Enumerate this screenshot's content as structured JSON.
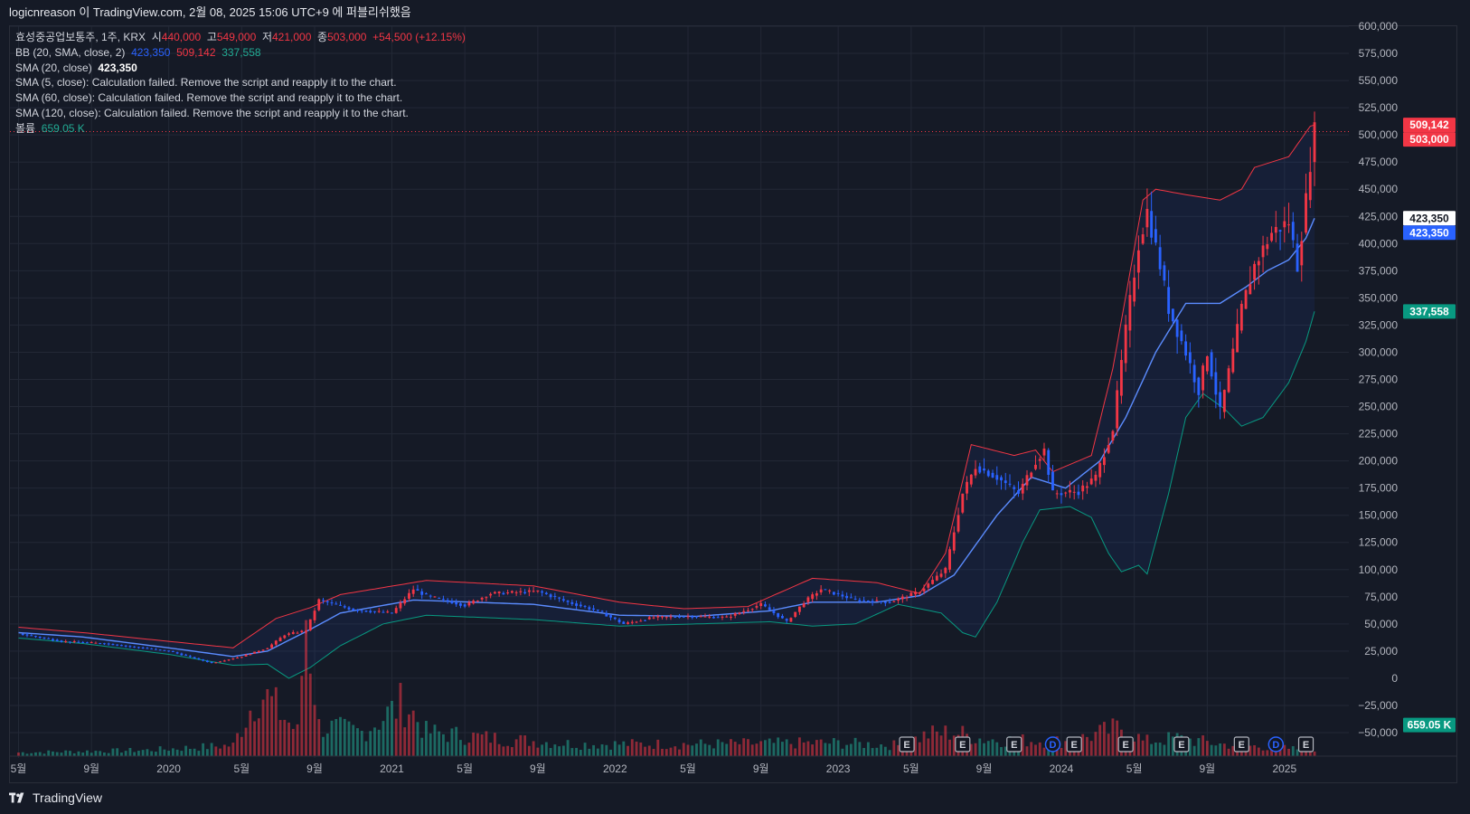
{
  "header": {
    "publish_line": "logicnreason 이 TradingView.com, 2월 08, 2025 15:06 UTC+9 에 퍼블리쉬했음"
  },
  "legend": {
    "symbol": "효성중공업보통주, 1주, KRX",
    "open_label": "시",
    "open": "440,000",
    "high_label": "고",
    "high": "549,000",
    "low_label": "저",
    "low": "421,000",
    "close_label": "종",
    "close": "503,000",
    "change": "+54,500 (+12.15%)",
    "bb_label": "BB (20, SMA, close, 2)",
    "bb_basis": "423,350",
    "bb_upper": "509,142",
    "bb_lower": "337,558",
    "sma20_label": "SMA (20, close)",
    "sma20_value": "423,350",
    "sma5_msg": "SMA (5, close): Calculation failed. Remove the script and reapply it to the chart.",
    "sma60_msg": "SMA (60, close): Calculation failed. Remove the script and reapply it to the chart.",
    "sma120_msg": "SMA (120, close): Calculation failed. Remove the script and reapply it to the chart.",
    "volume_label": "볼륨",
    "volume_value": "659.05 K"
  },
  "footer": {
    "brand": "TradingView"
  },
  "colors": {
    "up": "#f23645",
    "down": "#2962ff",
    "bb_upper": "#f23645",
    "bb_basis": "#5b8cff",
    "bb_lower": "#089981",
    "bg": "#151a26",
    "grid": "#232836"
  },
  "chart_data": {
    "type": "candlestick",
    "interval": "1W",
    "y_ticks": [
      "600,000",
      "575,000",
      "550,000",
      "525,000",
      "500,000",
      "475,000",
      "450,000",
      "425,000",
      "400,000",
      "375,000",
      "350,000",
      "325,000",
      "300,000",
      "275,000",
      "250,000",
      "225,000",
      "200,000",
      "175,000",
      "150,000",
      "125,000",
      "100,000",
      "75,000",
      "50,000",
      "25,000",
      "0",
      "−25,000",
      "−50,000"
    ],
    "ylim": [
      -50000,
      600000
    ],
    "x_labels": [
      "5월",
      "9월",
      "2020",
      "5월",
      "9월",
      "2021",
      "5월",
      "9월",
      "2022",
      "5월",
      "9월",
      "2023",
      "5월",
      "9월",
      "2024",
      "5월",
      "9월",
      "2025"
    ],
    "x_label_pos": [
      0,
      17,
      35,
      52,
      69,
      87,
      104,
      121,
      139,
      156,
      173,
      191,
      208,
      225,
      243,
      260,
      277,
      295
    ],
    "x_range": [
      -2,
      310
    ],
    "price_badges": [
      {
        "text": "509,142",
        "value": 509142,
        "bg": "#f23645",
        "fg": "#ffffff"
      },
      {
        "text": "503,000",
        "value": 503000,
        "bg": "#f23645",
        "fg": "#ffffff"
      },
      {
        "text": "423,350",
        "value": 423350,
        "bg": "#ffffff",
        "fg": "#131722"
      },
      {
        "text": "423,350",
        "value": 423350,
        "bg": "#2962ff",
        "fg": "#ffffff"
      },
      {
        "text": "337,558",
        "value": 337558,
        "bg": "#089981",
        "fg": "#ffffff"
      },
      {
        "text": "659.05 K",
        "value": -43000,
        "bg": "#089981",
        "fg": "#ffffff"
      }
    ],
    "last_price": 503000,
    "events": [
      {
        "type": "E",
        "x": 207
      },
      {
        "type": "E",
        "x": 220
      },
      {
        "type": "E",
        "x": 232
      },
      {
        "type": "D",
        "x": 241
      },
      {
        "type": "E",
        "x": 246
      },
      {
        "type": "E",
        "x": 258
      },
      {
        "type": "E",
        "x": 271
      },
      {
        "type": "E",
        "x": 285
      },
      {
        "type": "D",
        "x": 293
      },
      {
        "type": "E",
        "x": 300
      }
    ],
    "close_keypoints": [
      [
        0,
        41000
      ],
      [
        10,
        34000
      ],
      [
        20,
        32000
      ],
      [
        35,
        25000
      ],
      [
        45,
        14000
      ],
      [
        52,
        20000
      ],
      [
        58,
        28000
      ],
      [
        62,
        40000
      ],
      [
        67,
        44000
      ],
      [
        70,
        72000
      ],
      [
        78,
        63000
      ],
      [
        87,
        60000
      ],
      [
        92,
        82000
      ],
      [
        95,
        76000
      ],
      [
        104,
        67000
      ],
      [
        110,
        78000
      ],
      [
        121,
        80000
      ],
      [
        128,
        70000
      ],
      [
        135,
        62000
      ],
      [
        141,
        50000
      ],
      [
        148,
        56000
      ],
      [
        156,
        57000
      ],
      [
        165,
        56000
      ],
      [
        173,
        68000
      ],
      [
        179,
        52000
      ],
      [
        183,
        70000
      ],
      [
        187,
        82000
      ],
      [
        195,
        72000
      ],
      [
        203,
        70000
      ],
      [
        210,
        80000
      ],
      [
        216,
        100000
      ],
      [
        220,
        170000
      ],
      [
        223,
        195000
      ],
      [
        228,
        185000
      ],
      [
        233,
        170000
      ],
      [
        237,
        200000
      ],
      [
        239,
        210000
      ],
      [
        241,
        170000
      ],
      [
        247,
        172000
      ],
      [
        251,
        185000
      ],
      [
        255,
        230000
      ],
      [
        258,
        320000
      ],
      [
        261,
        400000
      ],
      [
        263,
        430000
      ],
      [
        266,
        380000
      ],
      [
        268,
        340000
      ],
      [
        272,
        300000
      ],
      [
        275,
        265000
      ],
      [
        277,
        300000
      ],
      [
        280,
        245000
      ],
      [
        283,
        300000
      ],
      [
        285,
        340000
      ],
      [
        288,
        380000
      ],
      [
        292,
        410000
      ],
      [
        296,
        420000
      ],
      [
        298,
        380000
      ],
      [
        300,
        440000
      ],
      [
        301,
        475000
      ],
      [
        302,
        503000
      ]
    ],
    "bb_upper_keypoints": [
      [
        0,
        47000
      ],
      [
        15,
        42000
      ],
      [
        35,
        34000
      ],
      [
        50,
        28000
      ],
      [
        60,
        55000
      ],
      [
        68,
        65000
      ],
      [
        75,
        77000
      ],
      [
        95,
        90000
      ],
      [
        120,
        85000
      ],
      [
        140,
        70000
      ],
      [
        155,
        64000
      ],
      [
        170,
        66000
      ],
      [
        185,
        92000
      ],
      [
        200,
        88000
      ],
      [
        210,
        78000
      ],
      [
        216,
        115000
      ],
      [
        222,
        215000
      ],
      [
        232,
        205000
      ],
      [
        237,
        210000
      ],
      [
        241,
        190000
      ],
      [
        250,
        205000
      ],
      [
        255,
        285000
      ],
      [
        262,
        440000
      ],
      [
        265,
        450000
      ],
      [
        272,
        445000
      ],
      [
        280,
        440000
      ],
      [
        285,
        450000
      ],
      [
        288,
        470000
      ],
      [
        296,
        480000
      ],
      [
        301,
        508000
      ],
      [
        302,
        509142
      ]
    ],
    "bb_basis_keypoints": [
      [
        0,
        42000
      ],
      [
        15,
        38000
      ],
      [
        35,
        28000
      ],
      [
        50,
        20000
      ],
      [
        58,
        25000
      ],
      [
        68,
        45000
      ],
      [
        75,
        60000
      ],
      [
        92,
        72000
      ],
      [
        120,
        68000
      ],
      [
        140,
        58000
      ],
      [
        158,
        57000
      ],
      [
        175,
        62000
      ],
      [
        185,
        70000
      ],
      [
        200,
        70000
      ],
      [
        210,
        76000
      ],
      [
        218,
        95000
      ],
      [
        228,
        150000
      ],
      [
        236,
        185000
      ],
      [
        244,
        175000
      ],
      [
        252,
        200000
      ],
      [
        258,
        240000
      ],
      [
        265,
        300000
      ],
      [
        272,
        345000
      ],
      [
        280,
        345000
      ],
      [
        286,
        360000
      ],
      [
        291,
        375000
      ],
      [
        296,
        385000
      ],
      [
        300,
        405000
      ],
      [
        302,
        423350
      ]
    ],
    "bb_lower_keypoints": [
      [
        0,
        37000
      ],
      [
        15,
        32000
      ],
      [
        35,
        22000
      ],
      [
        50,
        12000
      ],
      [
        58,
        13000
      ],
      [
        63,
        0
      ],
      [
        68,
        10000
      ],
      [
        75,
        30000
      ],
      [
        85,
        50000
      ],
      [
        95,
        58000
      ],
      [
        120,
        54000
      ],
      [
        140,
        48000
      ],
      [
        158,
        50000
      ],
      [
        175,
        52000
      ],
      [
        185,
        48000
      ],
      [
        195,
        50000
      ],
      [
        205,
        68000
      ],
      [
        215,
        60000
      ],
      [
        220,
        42000
      ],
      [
        223,
        38000
      ],
      [
        228,
        70000
      ],
      [
        234,
        125000
      ],
      [
        238,
        155000
      ],
      [
        245,
        158000
      ],
      [
        250,
        148000
      ],
      [
        254,
        115000
      ],
      [
        257,
        98000
      ],
      [
        261,
        104000
      ],
      [
        263,
        96000
      ],
      [
        268,
        170000
      ],
      [
        272,
        240000
      ],
      [
        276,
        262000
      ],
      [
        281,
        248000
      ],
      [
        285,
        232000
      ],
      [
        290,
        240000
      ],
      [
        296,
        272000
      ],
      [
        300,
        310000
      ],
      [
        302,
        337558
      ]
    ],
    "volume_keypoints": [
      [
        0,
        3
      ],
      [
        30,
        5
      ],
      [
        50,
        9
      ],
      [
        56,
        55
      ],
      [
        60,
        40
      ],
      [
        65,
        20
      ],
      [
        67,
        120
      ],
      [
        70,
        25
      ],
      [
        80,
        20
      ],
      [
        90,
        45
      ],
      [
        95,
        20
      ],
      [
        110,
        15
      ],
      [
        130,
        10
      ],
      [
        160,
        10
      ],
      [
        190,
        11
      ],
      [
        205,
        9
      ],
      [
        212,
        18
      ],
      [
        218,
        20
      ],
      [
        225,
        14
      ],
      [
        245,
        12
      ],
      [
        258,
        25
      ],
      [
        262,
        12
      ],
      [
        270,
        15
      ],
      [
        280,
        10
      ],
      [
        302,
        5
      ]
    ]
  }
}
